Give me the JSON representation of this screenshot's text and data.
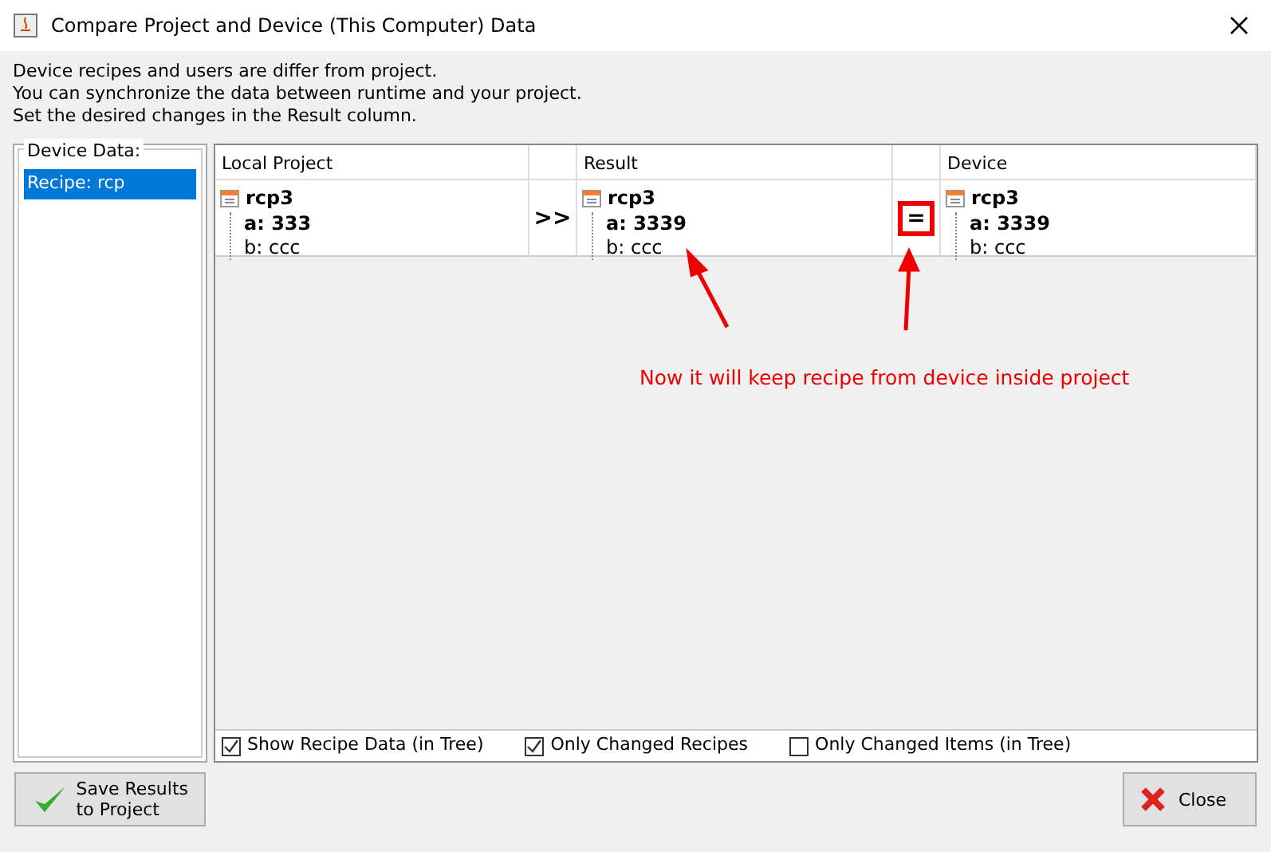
{
  "window": {
    "title": "Compare Project and Device (This Computer) Data"
  },
  "intro": [
    "Device recipes and users are differ from project.",
    "You can synchronize the data between runtime and your project.",
    "Set the desired changes in the Result column."
  ],
  "device_data": {
    "label": "Device Data:",
    "items": [
      {
        "label": "Recipe: rcp",
        "selected": true
      }
    ]
  },
  "table": {
    "columns": [
      {
        "kind": "data",
        "label": "Local Project"
      },
      {
        "kind": "action"
      },
      {
        "kind": "data",
        "label": "Result"
      },
      {
        "kind": "action"
      },
      {
        "kind": "data",
        "label": "Device"
      }
    ],
    "rows": [
      {
        "cells": [
          {
            "kind": "tree",
            "name": "rcp3",
            "children": [
              {
                "label": "a: 333",
                "differs": true
              },
              {
                "label": "b: ccc",
                "differs": false
              }
            ]
          },
          {
            "kind": "action",
            "symbol": ">>",
            "highlighted": false
          },
          {
            "kind": "tree",
            "name": "rcp3",
            "children": [
              {
                "label": "a: 3339",
                "differs": true
              },
              {
                "label": "b: ccc",
                "differs": false
              }
            ]
          },
          {
            "kind": "action",
            "symbol": "=",
            "highlighted": true
          },
          {
            "kind": "tree",
            "name": "rcp3",
            "children": [
              {
                "label": "a: 3339",
                "differs": true
              },
              {
                "label": "b: ccc",
                "differs": false
              }
            ]
          }
        ]
      }
    ]
  },
  "annotation": {
    "text": "Now it will keep recipe from device inside project"
  },
  "options": [
    {
      "label": "Show Recipe Data (in Tree)",
      "checked": true
    },
    {
      "label": "Only Changed Recipes",
      "checked": true
    },
    {
      "label": "Only Changed Items (in Tree)",
      "checked": false
    }
  ],
  "buttons": [
    {
      "kind": "save",
      "label": "Save Results\nto Project"
    },
    {
      "kind": "close",
      "label": "Close"
    }
  ]
}
